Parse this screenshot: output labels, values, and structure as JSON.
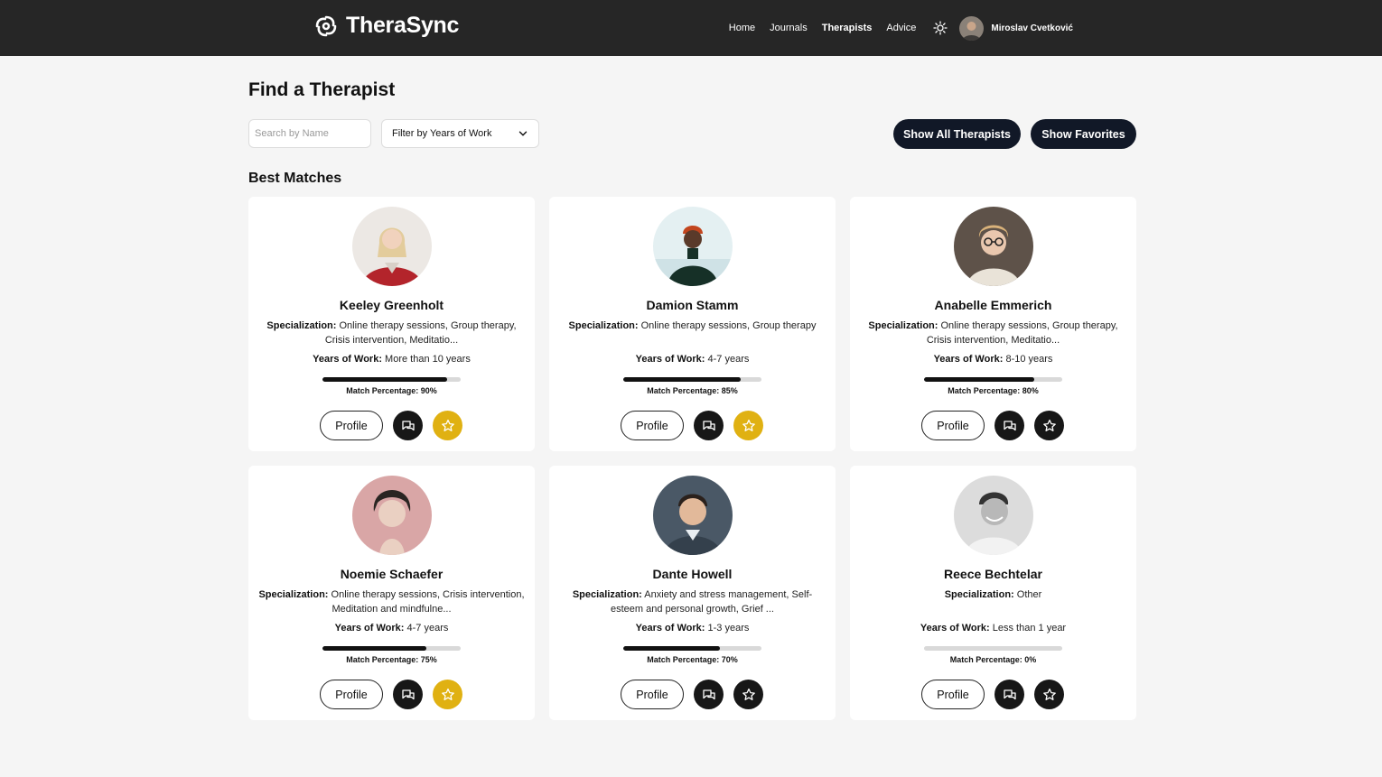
{
  "app": {
    "name": "TheraSync"
  },
  "nav": {
    "links": [
      {
        "label": "Home",
        "active": false
      },
      {
        "label": "Journals",
        "active": false
      },
      {
        "label": "Therapists",
        "active": true
      },
      {
        "label": "Advice",
        "active": false
      }
    ],
    "theme_icon": "sun-icon",
    "user_name": "Miroslav Cvetković"
  },
  "page": {
    "title": "Find a Therapist",
    "search_placeholder": "Search by Name",
    "search_value": "",
    "filter_label": "Filter by Years of Work",
    "show_all_label": "Show All Therapists",
    "show_favorites_label": "Show Favorites",
    "section_title": "Best Matches"
  },
  "labels": {
    "specialization": "Specialization:",
    "years": "Years of Work:",
    "match": "Match Percentage:",
    "profile": "Profile"
  },
  "colors": {
    "favorite": "#e0b112",
    "dark": "#171717",
    "header": "#262626",
    "pill": "#111827"
  },
  "therapists": [
    {
      "name": "Keeley Greenholt",
      "specialization": "Online therapy sessions, Group therapy, Crisis intervention, Meditatio...",
      "years": "More than 10 years",
      "match_text": "90%",
      "match": 0.9,
      "favorite": true
    },
    {
      "name": "Damion Stamm",
      "specialization": "Online therapy sessions, Group therapy",
      "years": "4-7 years",
      "match_text": "85%",
      "match": 0.85,
      "favorite": true
    },
    {
      "name": "Anabelle Emmerich",
      "specialization": "Online therapy sessions, Group therapy, Crisis intervention, Meditatio...",
      "years": "8-10 years",
      "match_text": "80%",
      "match": 0.8,
      "favorite": false
    },
    {
      "name": "Noemie Schaefer",
      "specialization": "Online therapy sessions, Crisis intervention, Meditation and mindfulne...",
      "years": "4-7 years",
      "match_text": "75%",
      "match": 0.75,
      "favorite": true
    },
    {
      "name": "Dante Howell",
      "specialization": "Anxiety and stress management, Self-esteem and personal growth, Grief ...",
      "years": "1-3 years",
      "match_text": "70%",
      "match": 0.7,
      "favorite": false
    },
    {
      "name": "Reece Bechtelar",
      "specialization": "Other",
      "years": "Less than 1 year",
      "match_text": "0%",
      "match": 0,
      "favorite": false
    }
  ]
}
